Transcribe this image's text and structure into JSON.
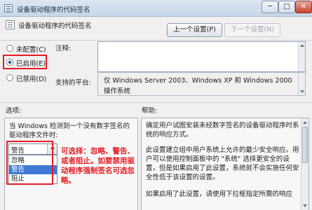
{
  "window": {
    "title": "设备驱动程序的代码签名",
    "min_glyph": "─",
    "max_glyph": "□",
    "close_glyph": "✕"
  },
  "header": {
    "heading": "设备驱动程序的代码签名",
    "prev_button": "上一个设置(P)",
    "next_button": "下一个设置(N)"
  },
  "state": {
    "options": [
      {
        "label": "未配置(C)",
        "checked": false
      },
      {
        "label": "已启用(E)",
        "checked": true
      },
      {
        "label": "已禁用(D)",
        "checked": false
      }
    ]
  },
  "comment": {
    "label": "注释:",
    "value": ""
  },
  "platform": {
    "label": "支持的平台:",
    "text": "仅 Windows Server 2003、Windows XP 和 Windows 2000 操作系统"
  },
  "options_section": {
    "label": "选项:",
    "description": "当 Windows 检测到一个没有数字签名的驱动程序文件时:",
    "selected": "警告",
    "items": [
      "忽略",
      "警告",
      "阻止"
    ],
    "selected_index": 1,
    "annotation": "可选择：忽略、警告、或者阻止。如要禁用驱动程序强制签名可选忽略。"
  },
  "help_section": {
    "label": "帮助:",
    "paragraphs": [
      "确定用户试图安装未经数字签名的设备驱动程序时系统的响应方式。",
      "此设置建立组中用户系统上允许的最少安全响应。用户可以使用控制面板中的 \"系统\" 选择更安全的设置，但是如果启用了此设置，系统就不会实施任何安全性低于该设置的设置。",
      "如果启用了此设置，请使用下拉框指定所需的响应"
    ]
  },
  "colors": {
    "highlight_red": "#e51d24",
    "selection_blue": "#3e7ad3"
  }
}
